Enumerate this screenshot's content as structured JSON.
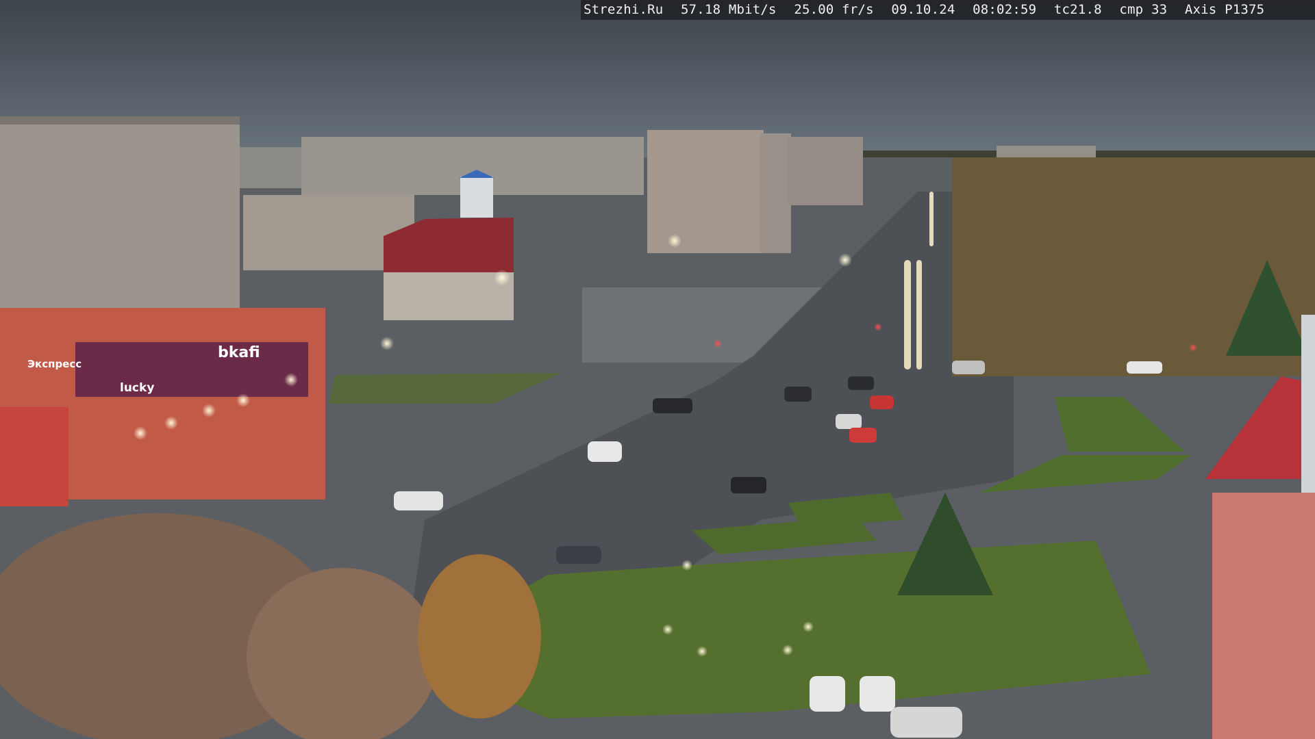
{
  "overlay": {
    "site": "Strezhi.Ru",
    "bitrate": "57.18 Mbit/s",
    "framerate": "25.00 fr/s",
    "date": "09.10.24",
    "time": "08:02:59",
    "tc": "tc21.8",
    "cmp": "cmp 33",
    "camera": "Axis P1375"
  },
  "signs": {
    "shop_left": "Экспресс",
    "shop_right": "lucky",
    "shop_far": "bkafi"
  },
  "colors": {
    "sky": "#4b5560",
    "road": "#55595e",
    "grass": "#4f6e2e",
    "brick": "#c25a48",
    "roof_red": "#b8323a"
  }
}
